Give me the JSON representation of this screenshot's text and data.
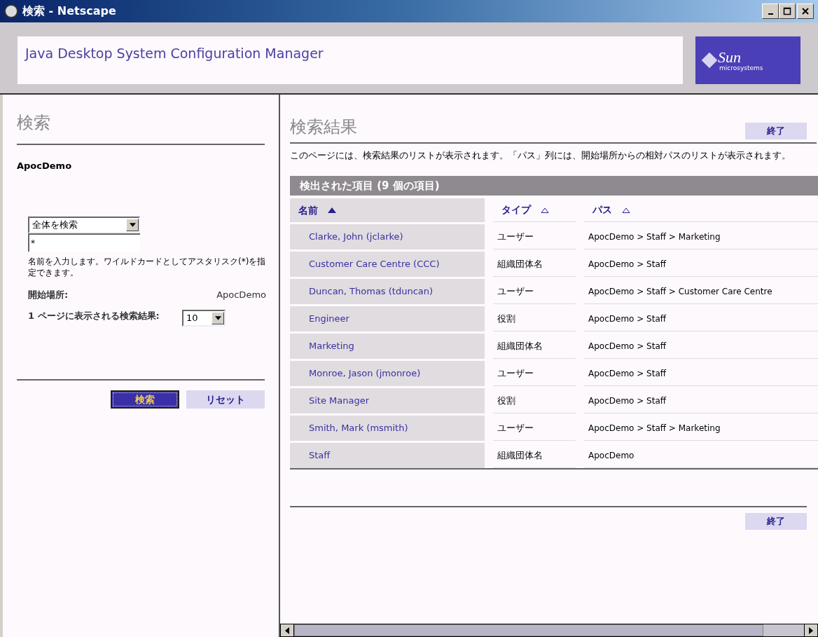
{
  "window": {
    "title": "検索 - Netscape"
  },
  "banner": {
    "title": "Java Desktop System Configuration Manager",
    "logo": "Sun",
    "logo_sub": "microsystems"
  },
  "search_panel": {
    "title": "検索",
    "context": "ApocDemo",
    "scope": "全体を検索",
    "query": "*",
    "help": "名前を入力します。ワイルドカードとしてアスタリスク(*)を指定できます。",
    "start_label": "開始場所:",
    "start_value": "ApocDemo",
    "per_page_label": "1 ページに表示される検索結果:",
    "per_page": "10",
    "buttons": [
      {
        "label": "検索",
        "kind": "primary"
      },
      {
        "label": "リセット",
        "kind": "secondary"
      }
    ]
  },
  "results": {
    "title": "検索結果",
    "close_top": "終了",
    "description": "このページには、検索結果のリストが表示されます。「パス」列には、開始場所からの相対パスのリストが表示されます。",
    "table_title": "検出された項目 (9 個の項目)",
    "columns": [
      {
        "label": "名前",
        "sorted": true
      },
      {
        "label": "タイプ",
        "sorted": false
      },
      {
        "label": "パス",
        "sorted": false
      }
    ],
    "rows": [
      {
        "name": "Clarke, John (jclarke)",
        "type": "ユーザー",
        "path": "ApocDemo > Staff > Marketing"
      },
      {
        "name": "Customer Care Centre (CCC)",
        "type": "組織団体名",
        "path": "ApocDemo > Staff"
      },
      {
        "name": "Duncan, Thomas (tduncan)",
        "type": "ユーザー",
        "path": "ApocDemo > Staff > Customer Care Centre"
      },
      {
        "name": "Engineer",
        "type": "役割",
        "path": "ApocDemo > Staff"
      },
      {
        "name": "Marketing",
        "type": "組織団体名",
        "path": "ApocDemo > Staff"
      },
      {
        "name": "Monroe, Jason (jmonroe)",
        "type": "ユーザー",
        "path": "ApocDemo > Staff"
      },
      {
        "name": "Site Manager",
        "type": "役割",
        "path": "ApocDemo > Staff"
      },
      {
        "name": "Smith, Mark (msmith)",
        "type": "ユーザー",
        "path": "ApocDemo > Staff > Marketing"
      },
      {
        "name": "Staff",
        "type": "組織団体名",
        "path": "ApocDemo"
      }
    ],
    "close_bottom": "終了"
  }
}
